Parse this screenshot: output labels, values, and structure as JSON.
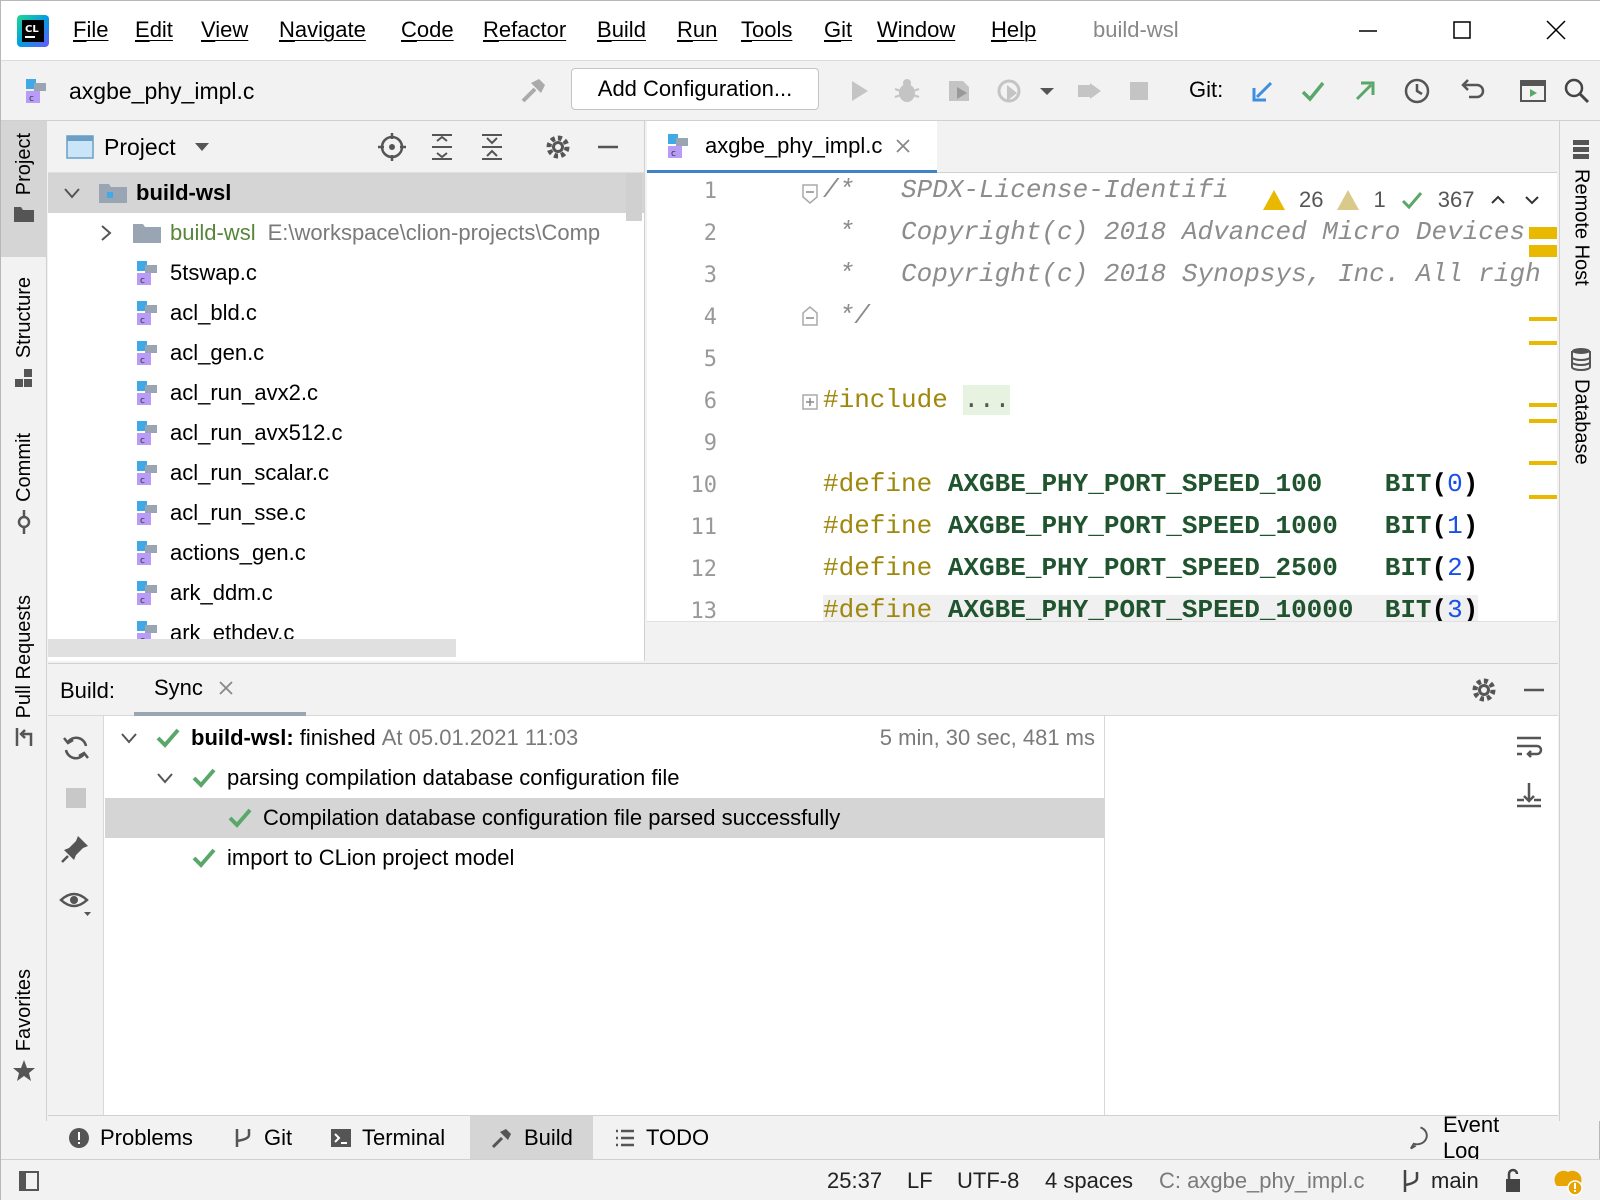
{
  "menubar": {
    "items": [
      "File",
      "Edit",
      "View",
      "Navigate",
      "Code",
      "Refactor",
      "Build",
      "Run",
      "Tools",
      "Git",
      "Window",
      "Help"
    ],
    "window_title": "build-wsl"
  },
  "toolbar": {
    "file_name": "axgbe_phy_impl.c",
    "add_configuration": "Add Configuration...",
    "git_label": "Git:"
  },
  "left_stripe": {
    "tabs": [
      "Project",
      "Structure",
      "Commit",
      "Pull Requests",
      "Favorites"
    ]
  },
  "right_stripe": {
    "tabs": [
      "Remote Host",
      "Database"
    ]
  },
  "project": {
    "title": "Project",
    "root": "build-wsl",
    "folder": "build-wsl",
    "folder_path": "E:\\workspace\\clion-projects\\Comp",
    "files": [
      "5tswap.c",
      "acl_bld.c",
      "acl_gen.c",
      "acl_run_avx2.c",
      "acl_run_avx512.c",
      "acl_run_scalar.c",
      "acl_run_sse.c",
      "actions_gen.c",
      "ark_ddm.c",
      "ark_ethdev.c"
    ]
  },
  "editor": {
    "tab_label": "axgbe_phy_impl.c",
    "inspection": {
      "warnings": "26",
      "weak_warnings": "1",
      "ok": "367"
    },
    "line_numbers": [
      "1",
      "2",
      "3",
      "4",
      "5",
      "6",
      "9",
      "10",
      "11",
      "12",
      "13"
    ],
    "lines": {
      "l1": "/*   SPDX-License-Identifi",
      "l2": " *   Copyright(c) 2018 Advanced Micro Devices",
      "l3": " *   Copyright(c) 2018 Synopsys, Inc. All righ",
      "l4": " */",
      "l6_kw": "#include",
      "l6_fold": "...",
      "define_kw": "#define",
      "d10_name": "AXGBE_PHY_PORT_SPEED_100",
      "d11_name": "AXGBE_PHY_PORT_SPEED_1000",
      "d12_name": "AXGBE_PHY_PORT_SPEED_2500",
      "d13_name": "AXGBE_PHY_PORT_SPEED_10000",
      "bit": "BIT",
      "v10": "0",
      "v11": "1",
      "v12": "2",
      "v13": "3"
    }
  },
  "build": {
    "label": "Build:",
    "tab": "Sync",
    "root_name": "build-wsl:",
    "root_status": "finished",
    "root_time": "At 05.01.2021 11:03",
    "duration": "5 min, 30 sec, 481 ms",
    "step1": "parsing compilation database configuration file",
    "step1_child": "Compilation database configuration file parsed successfully",
    "step2": "import to CLion project model"
  },
  "tool_tabs": [
    "Problems",
    "Git",
    "Terminal",
    "Build",
    "TODO"
  ],
  "event_log": "Event Log",
  "status": {
    "position": "25:37",
    "line_sep": "LF",
    "encoding": "UTF-8",
    "indent": "4 spaces",
    "context": "C: axgbe_phy_impl.c",
    "branch": "main"
  },
  "colors": {
    "accent": "#4083c9",
    "success": "#59a869",
    "warning": "#e8b900"
  }
}
